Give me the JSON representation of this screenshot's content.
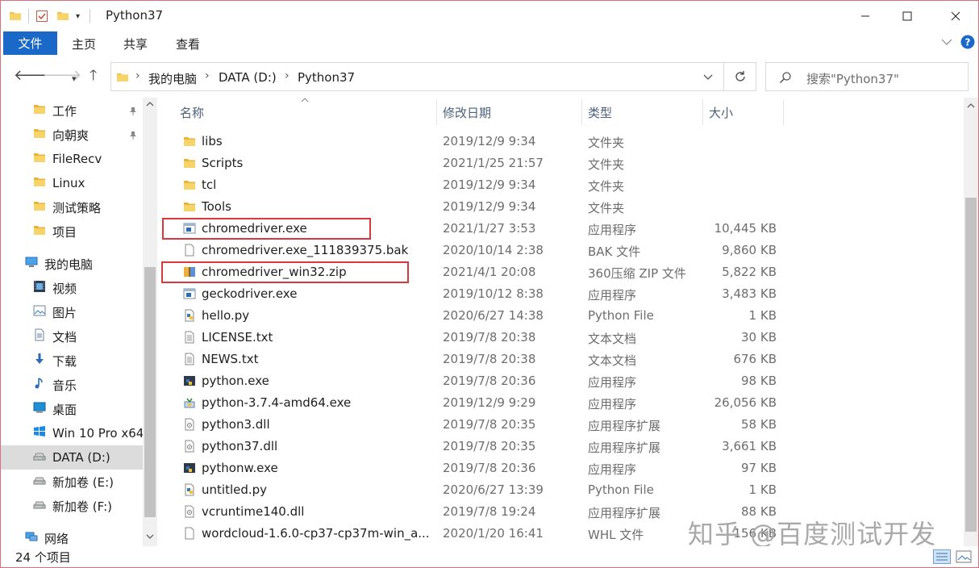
{
  "window": {
    "title": "Python37"
  },
  "ribbon": {
    "file_tab": "文件",
    "tabs": [
      "主页",
      "共享",
      "查看"
    ]
  },
  "address": {
    "crumbs": [
      "我的电脑",
      "DATA (D:)",
      "Python37"
    ],
    "search_placeholder": "搜索\"Python37\""
  },
  "nav": {
    "items": [
      {
        "label": "工作",
        "icon": "folder-icon",
        "pinned": true
      },
      {
        "label": "向朝爽",
        "icon": "folder-icon",
        "pinned": true
      },
      {
        "label": "FileRecv",
        "icon": "folder-icon"
      },
      {
        "label": "Linux",
        "icon": "folder-icon"
      },
      {
        "label": "测试策略",
        "icon": "folder-icon"
      },
      {
        "label": "项目",
        "icon": "folder-icon"
      },
      {
        "label": "我的电脑",
        "icon": "computer-icon"
      },
      {
        "label": "视频",
        "icon": "video-icon"
      },
      {
        "label": "图片",
        "icon": "pictures-icon"
      },
      {
        "label": "文档",
        "icon": "documents-icon"
      },
      {
        "label": "下载",
        "icon": "download-icon"
      },
      {
        "label": "音乐",
        "icon": "music-icon"
      },
      {
        "label": "桌面",
        "icon": "desktop-icon"
      },
      {
        "label": "Win 10 Pro x64",
        "icon": "windows-drive-icon"
      },
      {
        "label": "DATA (D:)",
        "icon": "drive-icon",
        "selected": true
      },
      {
        "label": "新加卷 (E:)",
        "icon": "drive-icon"
      },
      {
        "label": "新加卷 (F:)",
        "icon": "drive-icon"
      },
      {
        "label": "网络",
        "icon": "network-icon"
      }
    ]
  },
  "columns": {
    "name": "名称",
    "date": "修改日期",
    "type": "类型",
    "size": "大小"
  },
  "files": [
    {
      "name": "libs",
      "date": "2019/12/9 9:34",
      "type": "文件夹",
      "size": "",
      "icon": "folder-icon"
    },
    {
      "name": "Scripts",
      "date": "2021/1/25 21:57",
      "type": "文件夹",
      "size": "",
      "icon": "folder-icon"
    },
    {
      "name": "tcl",
      "date": "2019/12/9 9:34",
      "type": "文件夹",
      "size": "",
      "icon": "folder-icon"
    },
    {
      "name": "Tools",
      "date": "2019/12/9 9:34",
      "type": "文件夹",
      "size": "",
      "icon": "folder-icon"
    },
    {
      "name": "chromedriver.exe",
      "date": "2021/1/27 3:53",
      "type": "应用程序",
      "size": "10,445 KB",
      "icon": "exe-icon"
    },
    {
      "name": "chromedriver.exe_111839375.bak",
      "date": "2020/10/14 2:38",
      "type": "BAK 文件",
      "size": "9,860 KB",
      "icon": "blank-file-icon"
    },
    {
      "name": "chromedriver_win32.zip",
      "date": "2021/4/1 20:08",
      "type": "360压缩 ZIP 文件",
      "size": "5,822 KB",
      "icon": "zip-icon"
    },
    {
      "name": "geckodriver.exe",
      "date": "2019/10/12 8:38",
      "type": "应用程序",
      "size": "3,483 KB",
      "icon": "exe-icon"
    },
    {
      "name": "hello.py",
      "date": "2020/6/27 14:38",
      "type": "Python File",
      "size": "1 KB",
      "icon": "python-file-icon"
    },
    {
      "name": "LICENSE.txt",
      "date": "2019/7/8 20:38",
      "type": "文本文档",
      "size": "30 KB",
      "icon": "text-file-icon"
    },
    {
      "name": "NEWS.txt",
      "date": "2019/7/8 20:38",
      "type": "文本文档",
      "size": "676 KB",
      "icon": "text-file-icon"
    },
    {
      "name": "python.exe",
      "date": "2019/7/8 20:36",
      "type": "应用程序",
      "size": "98 KB",
      "icon": "python-exe-icon"
    },
    {
      "name": "python-3.7.4-amd64.exe",
      "date": "2019/12/9 9:29",
      "type": "应用程序",
      "size": "26,056 KB",
      "icon": "installer-icon"
    },
    {
      "name": "python3.dll",
      "date": "2019/7/8 20:35",
      "type": "应用程序扩展",
      "size": "58 KB",
      "icon": "dll-icon"
    },
    {
      "name": "python37.dll",
      "date": "2019/7/8 20:35",
      "type": "应用程序扩展",
      "size": "3,661 KB",
      "icon": "dll-icon"
    },
    {
      "name": "pythonw.exe",
      "date": "2019/7/8 20:36",
      "type": "应用程序",
      "size": "97 KB",
      "icon": "python-exe-icon"
    },
    {
      "name": "untitled.py",
      "date": "2020/6/27 13:39",
      "type": "Python File",
      "size": "1 KB",
      "icon": "python-file-icon"
    },
    {
      "name": "vcruntime140.dll",
      "date": "2019/7/8 19:24",
      "type": "应用程序扩展",
      "size": "88 KB",
      "icon": "dll-icon"
    },
    {
      "name": "wordcloud-1.6.0-cp37-cp37m-win_a...",
      "date": "2020/1/20 16:41",
      "type": "WHL 文件",
      "size": "156 KB",
      "icon": "blank-file-icon"
    }
  ],
  "status": {
    "count_text": "24 个项目"
  },
  "watermark": "知乎 @百度测试开发",
  "colors": {
    "accent": "#1a69c9",
    "highlight": "#d9383f",
    "folder": "#f4c247"
  }
}
